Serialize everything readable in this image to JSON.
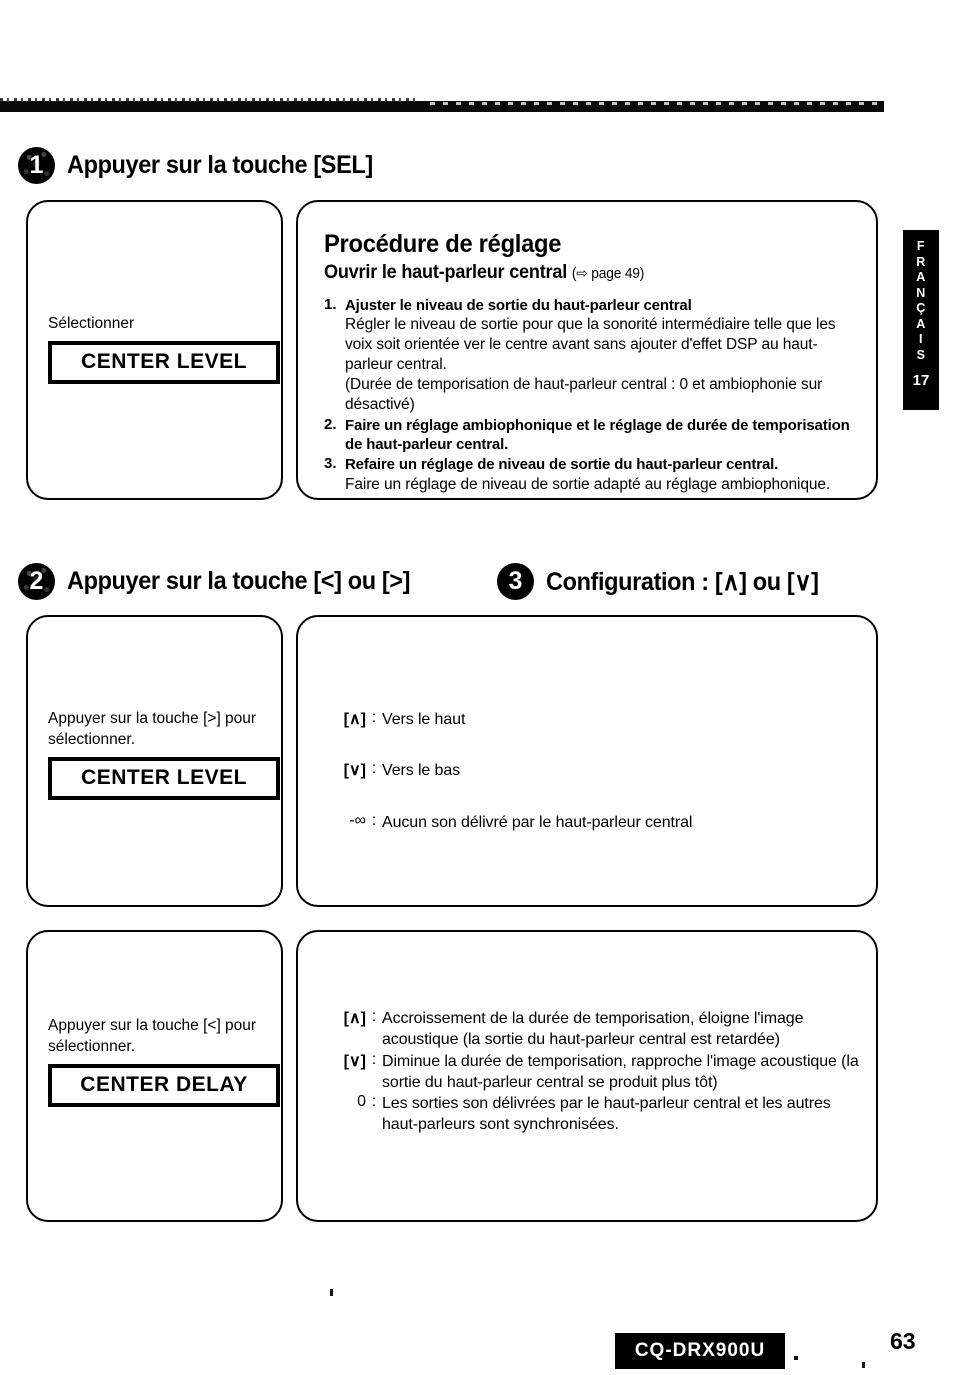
{
  "page": {
    "number": "63",
    "model": "CQ-DRX900U",
    "side_tab": {
      "letters": [
        "F",
        "R",
        "A",
        "N",
        "Ç",
        "A",
        "I",
        "S"
      ],
      "number": "17"
    }
  },
  "steps": [
    {
      "badge": "1",
      "title": "Appuyer sur la touche [SEL]"
    },
    {
      "badge": "2",
      "title": "Appuyer sur la touche [<] ou [>]"
    },
    {
      "badge": "3",
      "title": "Configuration : [∧] ou [∨]"
    }
  ],
  "row1": {
    "left": {
      "caption": "Sélectionner",
      "display": "CENTER LEVEL"
    },
    "right": {
      "title": "Procédure de réglage",
      "subtitle": "Ouvrir le haut-parleur central",
      "subtitle_ref": "(⇨ page 49)",
      "items": [
        {
          "num": "1.",
          "lead": "Ajuster le niveau de sortie du haut-parleur central",
          "desc": "Régler le niveau de sortie pour que la sonorité intermédiaire telle que les voix soit orientée ver le centre avant sans ajouter d'effet DSP au haut-parleur central.",
          "desc2": "(Durée de temporisation de haut-parleur central : 0 et ambiophonie sur désactivé)"
        },
        {
          "num": "2.",
          "lead": "Faire un réglage ambiophonique et le réglage de durée de temporisation de haut-parleur central.",
          "desc": "",
          "desc2": ""
        },
        {
          "num": "3.",
          "lead": "Refaire un réglage de niveau de sortie du haut-parleur central.",
          "desc": "Faire un réglage de niveau de sortie adapté au réglage ambiophonique.",
          "desc2": ""
        }
      ]
    }
  },
  "row2": {
    "left": {
      "caption": "Appuyer sur la touche [>] pour sélectionner.",
      "display": "CENTER LEVEL"
    },
    "right": {
      "definitions": [
        {
          "key": "[∧]",
          "value": "Vers le haut"
        },
        {
          "key": "[∨]",
          "value": "Vers le bas"
        },
        {
          "key": "-∞",
          "value": "Aucun son délivré par le haut-parleur central"
        }
      ]
    }
  },
  "row3": {
    "left": {
      "caption": "Appuyer sur la touche [<] pour sélectionner.",
      "display": "CENTER DELAY"
    },
    "right": {
      "definitions": [
        {
          "key": "[∧]",
          "value": "Accroissement de la durée de temporisation, éloigne l'image acoustique (la sortie du haut-parleur central est retardée)"
        },
        {
          "key": "[∨]",
          "value": "Diminue la durée de temporisation, rapproche l'image acoustique (la sortie du haut-parleur central se produit plus tôt)"
        },
        {
          "key": "0",
          "value": "Les sorties son délivrées par le haut-parleur central et les autres haut-parleurs sont synchronisées."
        }
      ]
    }
  }
}
